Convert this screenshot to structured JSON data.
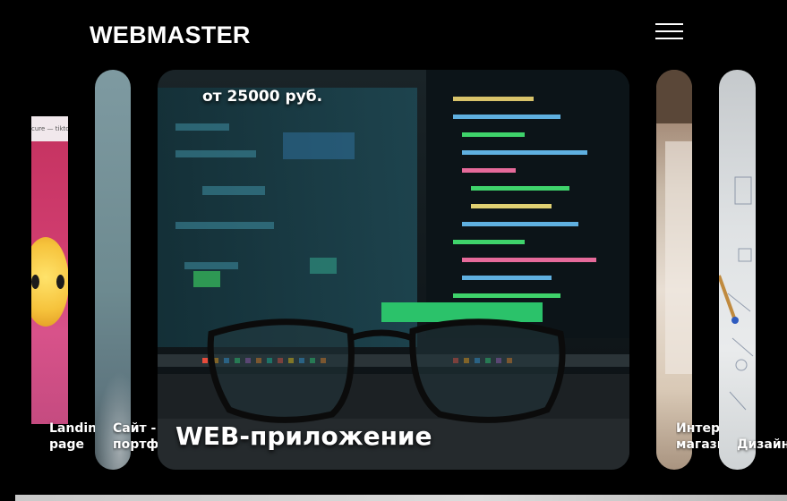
{
  "header": {
    "logo": "WEBMASTER",
    "menu_icon": "hamburger-menu-icon"
  },
  "cards": {
    "landing": {
      "caption_line1": "Landin",
      "caption_line2": "page",
      "browser_text": "cure — tikto"
    },
    "portfolio": {
      "caption_line1": "Сайт -",
      "caption_line2": "портфо"
    },
    "main": {
      "price": "от 25000 руб.",
      "title": "WEB-приложение"
    },
    "shop": {
      "caption_line1": "Интер",
      "caption_line2": "магази"
    },
    "design": {
      "caption_line1": "Дизайн"
    }
  },
  "colors": {
    "background": "#000000",
    "text": "#ffffff",
    "landing_pink": "#cf3c6e"
  }
}
